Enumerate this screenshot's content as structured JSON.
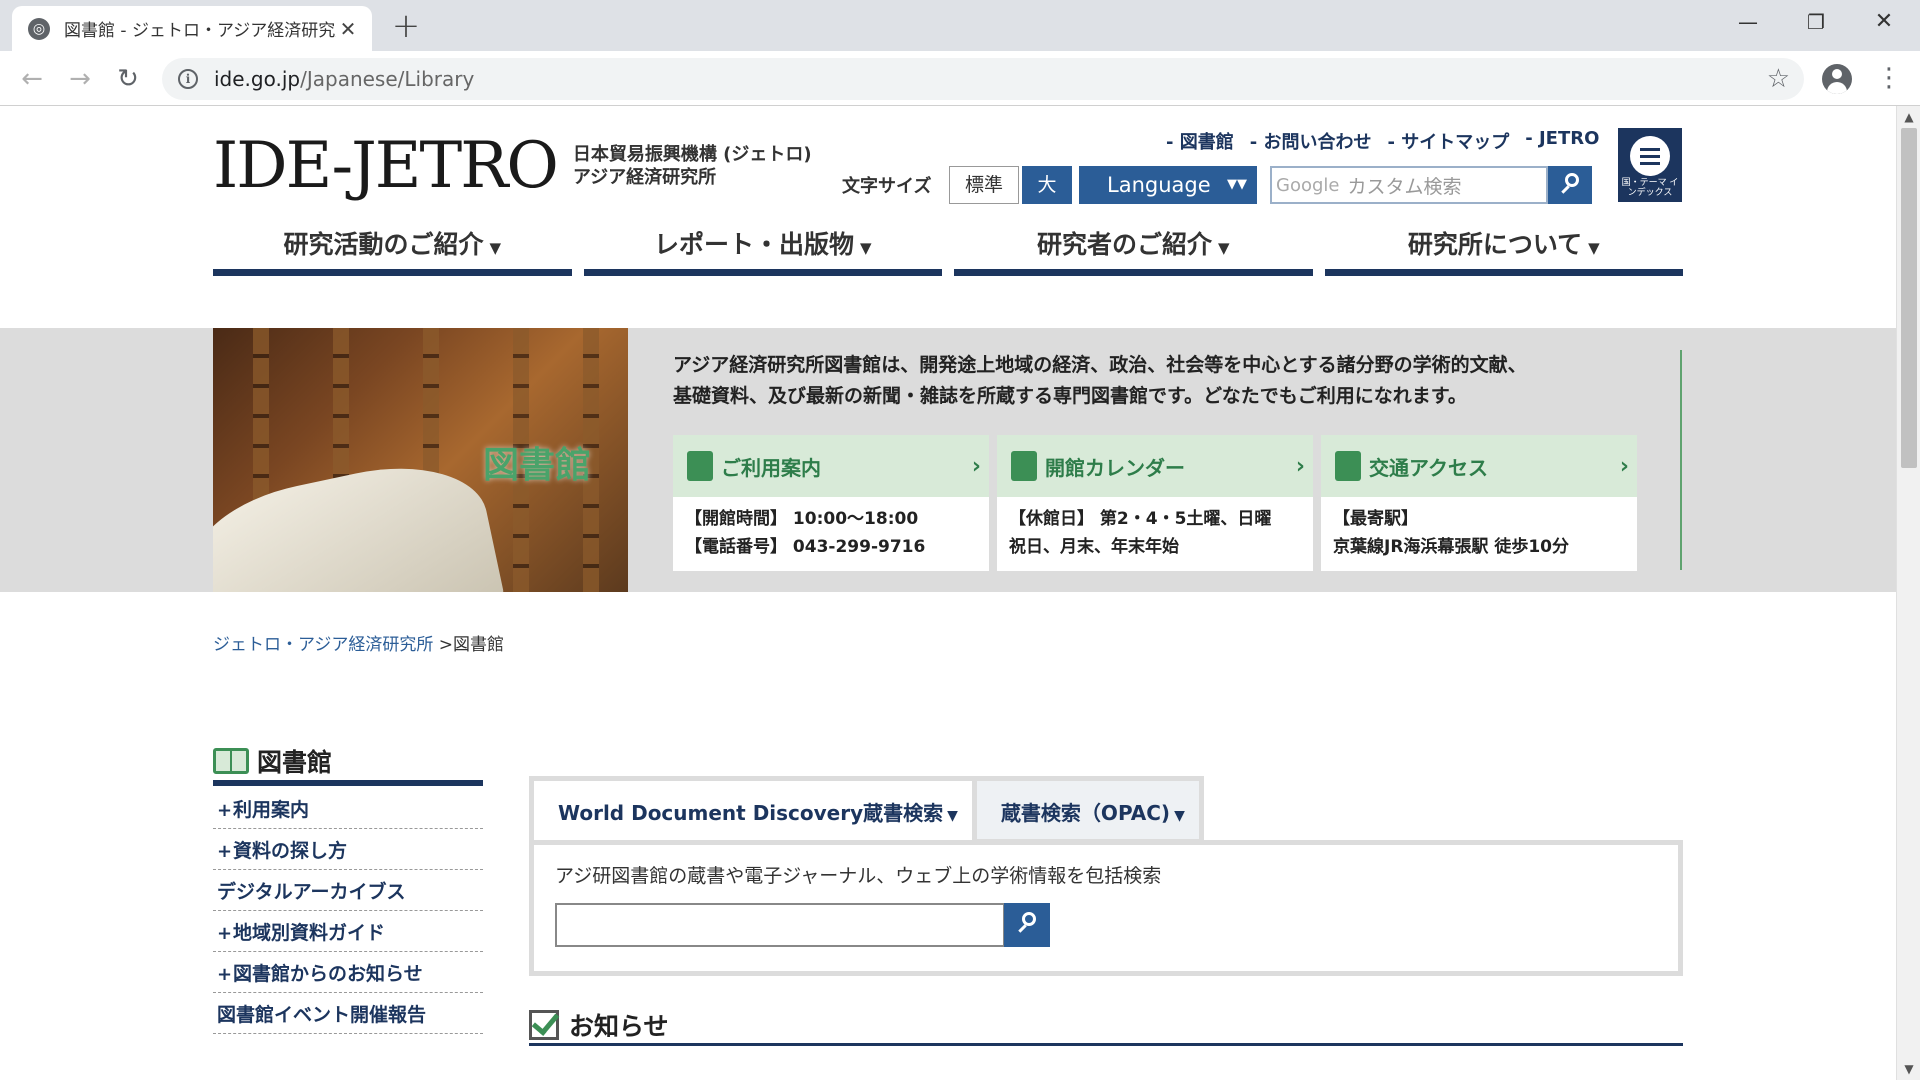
{
  "browser": {
    "tab_title": "図書館 - ジェトロ・アジア経済研究所",
    "tab_close": "✕",
    "new_tab": "+",
    "url_host": "ide.go.jp",
    "url_path": "/Japanese/Library",
    "win_min": "—",
    "win_max": "❐",
    "win_close": "✕"
  },
  "header": {
    "logo_text": "IDE-JETRO",
    "logo_sub_1": "日本貿易振興機構 (ジェトロ)",
    "logo_sub_2": "アジア経済研究所",
    "top_links": [
      "- 図書館",
      "- お問い合わせ",
      "- サイトマップ",
      "- JETRO"
    ],
    "font_size_label": "文字サイズ",
    "font_std": "標準",
    "font_large": "大",
    "language": "Language",
    "language_caret": "▼▼",
    "search_google": "Google",
    "search_placeholder": "カスタム検索",
    "index_label": "国・テーマ インデックス"
  },
  "main_nav": [
    {
      "label": "研究活動のご紹介",
      "tri": "▼"
    },
    {
      "label": "レポート・出版物",
      "tri": "▼"
    },
    {
      "label": "研究者のご紹介",
      "tri": "▼"
    },
    {
      "label": "研究所について",
      "tri": "▼"
    }
  ],
  "hero": {
    "image_label": "図書館",
    "text_1": "アジア経済研究所図書館は、開発途上地域の経済、政治、社会等を中心とする諸分野の学術的文献、",
    "text_2": "基礎資料、及び最新の新聞・雑誌を所蔵する専門図書館です。どなたでもご利用になれます。",
    "cards": [
      {
        "title": "ご利用案内",
        "line1": "【開館時間】 10:00～18:00",
        "line2": "【電話番号】 043-299-9716"
      },
      {
        "title": "開館カレンダー",
        "line1": "【休館日】 第2・4・5土曜、日曜",
        "line2": "祝日、月末、年末年始"
      },
      {
        "title": "交通アクセス",
        "line1": "【最寄駅】",
        "line2": "京葉線JR海浜幕張駅 徒歩10分"
      }
    ],
    "chevron": "›"
  },
  "breadcrumb": {
    "home": "ジェトロ・アジア経済研究所",
    "sep": " >",
    "current": "図書館"
  },
  "sidebar": {
    "title": "図書館",
    "items": [
      {
        "plus": "+",
        "label": "利用案内"
      },
      {
        "plus": "+",
        "label": "資料の探し方"
      },
      {
        "plus": "",
        "label": "デジタルアーカイブス"
      },
      {
        "plus": "+",
        "label": "地域別資料ガイド"
      },
      {
        "plus": "+",
        "label": "図書館からのお知らせ"
      },
      {
        "plus": "",
        "label": "図書館イベント開催報告"
      }
    ]
  },
  "search": {
    "tab_active": "World Document Discovery蔵書検索",
    "tab_inactive": "蔵書検索（OPAC)",
    "tri": "▼",
    "description": "アジ研図書館の蔵書や電子ジャーナル、ウェブ上の学術情報を包括検索",
    "input_value": ""
  },
  "news": {
    "title": "お知らせ"
  },
  "colors": {
    "navy": "#1c355e",
    "blue": "#2b5d97",
    "green": "#2e7d4a",
    "band": "#dcdcdc"
  }
}
